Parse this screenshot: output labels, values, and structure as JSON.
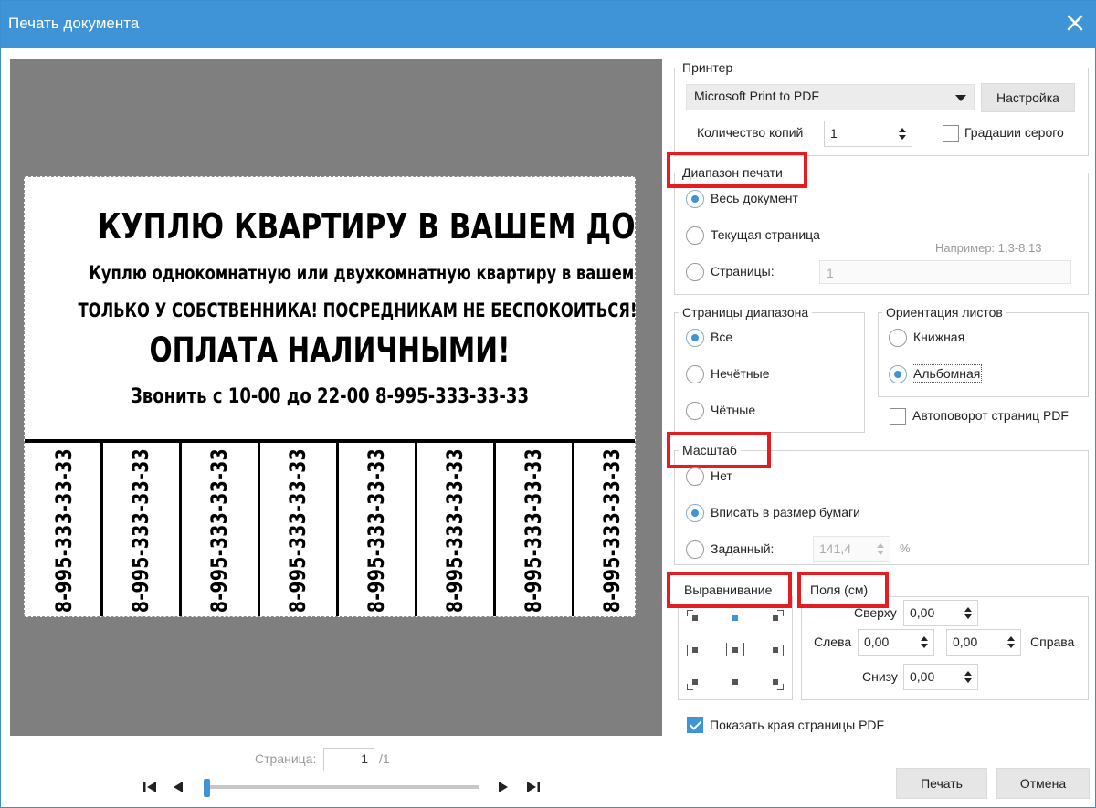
{
  "window": {
    "title": "Печать документа"
  },
  "preview": {
    "ad": {
      "title": "КУПЛЮ КВАРТИРУ В ВАШЕМ ДОМЕ",
      "line1": "Куплю однокомнатную или двухкомнатную квартиру в вашем доме.",
      "line2": "ТОЛЬКО У СОБСТВЕННИКА! ПОСРЕДНИКАМ НЕ БЕСПОКОИТЬСЯ!",
      "payment": "ОПЛАТА НАЛИЧНЫМИ!",
      "call": "Звонить с 10-00 до 22-00   8-995-333-33-33",
      "tabs": [
        "8-995-333-33-33",
        "8-995-333-33-33",
        "8-995-333-33-33",
        "8-995-333-33-33",
        "8-995-333-33-33",
        "8-995-333-33-33",
        "8-995-333-33-33",
        "8-995-333-33-33"
      ]
    }
  },
  "pager": {
    "label": "Страница:",
    "current": "1",
    "total": "/1",
    "position": 0.0
  },
  "printer": {
    "legend": "Принтер",
    "selected": "Microsoft Print to PDF",
    "setup_label": "Настройка",
    "copies_label": "Количество копий",
    "copies_value": "1",
    "grayscale_label": "Градации серого",
    "grayscale_checked": false
  },
  "range": {
    "legend": "Диапазон печати",
    "options": [
      "Весь документ",
      "Текущая страница",
      "Страницы:"
    ],
    "selected": 0,
    "example": "Например: 1,3-8,13",
    "pages_value": "1"
  },
  "subset": {
    "legend": "Страницы диапазона",
    "options": [
      "Все",
      "Нечётные",
      "Чётные"
    ],
    "selected": 0
  },
  "orientation": {
    "legend": "Ориентация листов",
    "options": [
      "Книжная",
      "Альбомная"
    ],
    "selected": 1,
    "autorotate_label": "Автоповорот страниц PDF",
    "autorotate_checked": false
  },
  "scale": {
    "legend": "Масштаб",
    "options": [
      "Нет",
      "Вписать в размер бумаги",
      "Заданный:"
    ],
    "selected": 1,
    "custom_value": "141,4",
    "unit": "%"
  },
  "alignment": {
    "legend": "Выравнивание",
    "selected": "top-center"
  },
  "margins": {
    "legend": "Поля (см)",
    "top_label": "Сверху",
    "top": "0,00",
    "left_label": "Слева",
    "left": "0,00",
    "right_label": "Справа",
    "right": "0,00",
    "bottom_label": "Снизу",
    "bottom": "0,00"
  },
  "show_edges": {
    "label": "Показать края страницы PDF",
    "checked": true
  },
  "buttons": {
    "print": "Печать",
    "cancel": "Отмена"
  },
  "colors": {
    "titlebar": "#3e94d6",
    "accent": "#3e94d6",
    "highlight": "#e51c22",
    "preview_bg": "#7f7f7f"
  }
}
